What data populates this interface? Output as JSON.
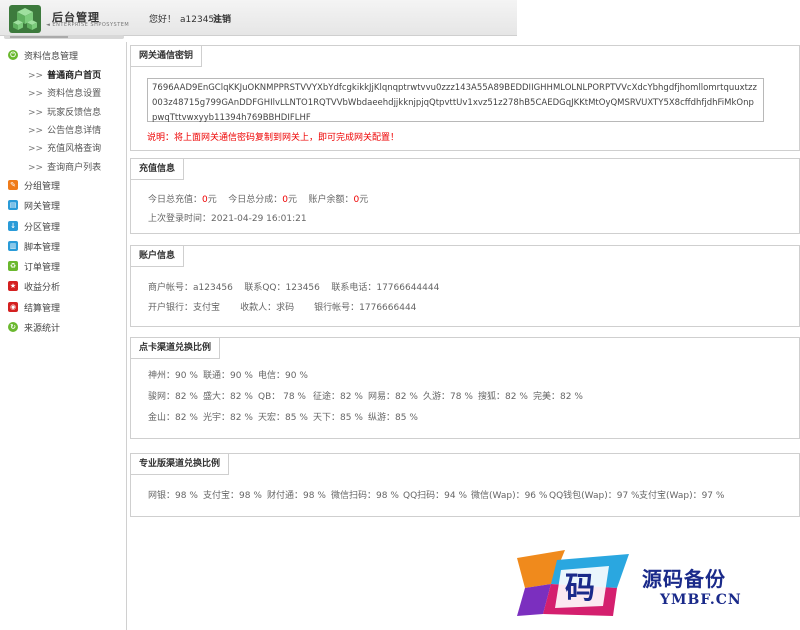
{
  "header": {
    "brand_title": "后台管理",
    "brand_sub": "◄ ENTERPRISE SHPOSYSTEM",
    "greeting": "您好！",
    "username": "a123456",
    "logout": "注销"
  },
  "sidebar": {
    "group1": {
      "label": "资料信息管理",
      "icon": "power-icon",
      "color": "#6ab82e"
    },
    "subitems": [
      {
        "label": "普通商户首页",
        "active": true
      },
      {
        "label": "资料信息设置"
      },
      {
        "label": "玩家反馈信息"
      },
      {
        "label": "公告信息详情"
      },
      {
        "label": "充值风格查询"
      },
      {
        "label": "查询商户列表"
      }
    ],
    "items": [
      {
        "label": "分组管理",
        "icon": "pencil-icon",
        "color": "#ef7b1a"
      },
      {
        "label": "网关管理",
        "icon": "gateway-icon",
        "color": "#2a9bd8"
      },
      {
        "label": "分区管理",
        "icon": "download-icon",
        "color": "#2a9bd8"
      },
      {
        "label": "脚本管理",
        "icon": "script-icon",
        "color": "#2a9bd8"
      },
      {
        "label": "订单管理",
        "icon": "recycle-icon",
        "color": "#6ab82e"
      },
      {
        "label": "收益分析",
        "icon": "star-icon",
        "color": "#d42020"
      },
      {
        "label": "结算管理",
        "icon": "settle-icon",
        "color": "#d42020"
      },
      {
        "label": "来源统计",
        "icon": "refresh-icon",
        "color": "#6ab82e"
      }
    ]
  },
  "gateway": {
    "title": "网关通信密钥",
    "key": "7696AAD9EnGClqKKJuOKNMPPRSTVVYXbYdfcgkikkJjKlqnqptrwtvvu0zzz143A55A89BEDDIIGHHMLOLNLPORPTVVcXdcYbhgdfjhomllomrtquuxtzz003z48715g799GAnDDFGHIlvLLNTO1RQTVVbWbdaeehdjjkknjpjqQtpvttUv1xvz51z278hB5CAEDGqJKKtMtOyQMSRVUXTY5X8cffdhfjdhFiMkOnppwqTttvwxyyb11394h769BBHDIFLHF",
    "note": "说明：将上面网关通信密码复制到网关上，即可完成网关配置！"
  },
  "recharge": {
    "title": "充值信息",
    "today_total_label": "今日总充值：",
    "today_total": "0",
    "today_split_label": "今日总分成：",
    "today_split": "0",
    "balance_label": "账户余额：",
    "balance": "0",
    "unit": "元",
    "last_login_label": "上次登录时间：",
    "last_login": "2021-04-29 16:01:21"
  },
  "account": {
    "title": "账户信息",
    "merchant_label": "商户帐号：",
    "merchant": "a123456",
    "qq_label": "联系QQ：",
    "qq": "123456",
    "phone_label": "联系电话：",
    "phone": "17766644444",
    "bank_label": "开户银行：",
    "bank": "支付宝",
    "payee_label": "收款人：",
    "payee": "求码",
    "bank_no_label": "银行帐号：",
    "bank_no": "1776666444"
  },
  "card_rates": {
    "title": "点卡渠道兑换比例",
    "rows": [
      [
        "神州：90 %",
        "联通：90 %",
        "电信：90 %"
      ],
      [
        "骏网：82 %",
        "盛大：82 %",
        "QB：  78 %",
        "征途：82 %",
        "网易：82 %",
        "久游：78 %",
        "搜狐：82 %",
        "完美：82 %"
      ],
      [
        "金山：82 %",
        "光宇：82 %",
        "天宏：85 %",
        "天下：85 %",
        "纵游：85 %"
      ]
    ]
  },
  "pro_rates": {
    "title": "专业版渠道兑换比例",
    "items": [
      "网银：98 %",
      "支付宝：98 %",
      "财付通：98 %",
      "微信扫码：98 %",
      "QQ扫码：94 %",
      "微信(Wap)：96 %",
      "QQ钱包(Wap)：97 %",
      "支付宝(Wap)：97 %"
    ]
  },
  "watermark": {
    "glyph": "码",
    "text": "源码备份",
    "url": "YMBF.CN"
  }
}
